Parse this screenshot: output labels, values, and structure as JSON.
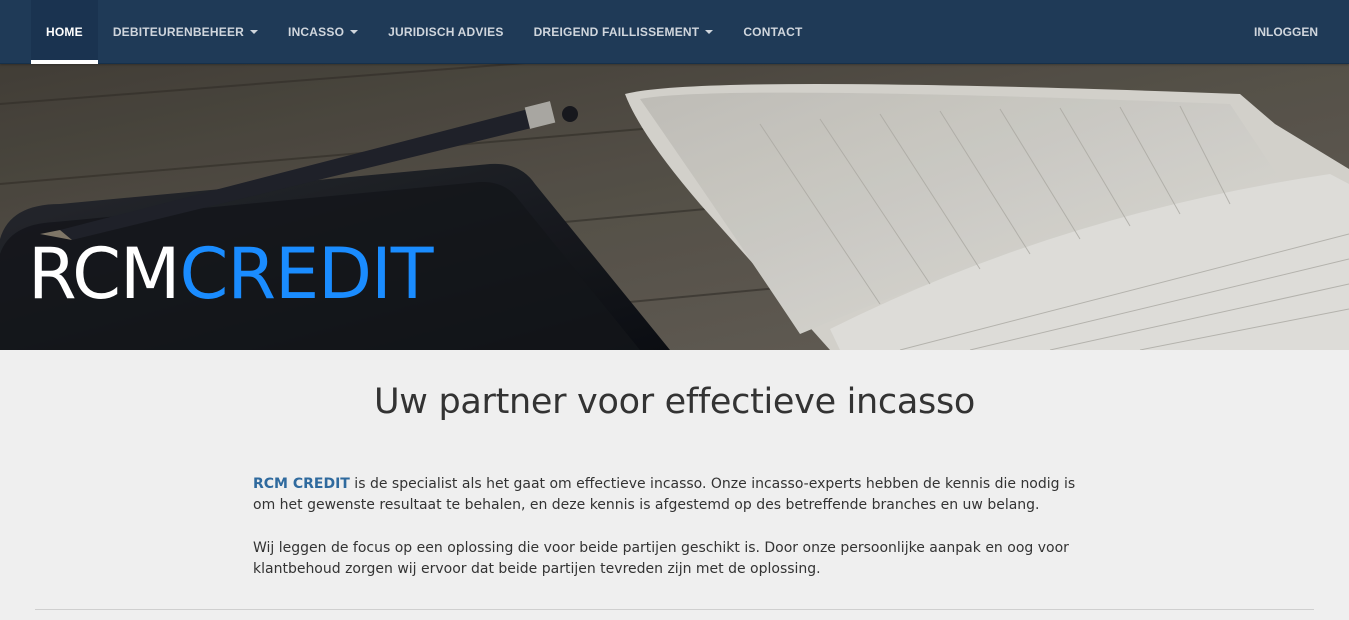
{
  "nav": {
    "items": [
      {
        "label": "HOME",
        "active": true,
        "dropdown": false
      },
      {
        "label": "DEBITEURENBEHEER",
        "active": false,
        "dropdown": true
      },
      {
        "label": "INCASSO",
        "active": false,
        "dropdown": true
      },
      {
        "label": "JURIDISCH ADVIES",
        "active": false,
        "dropdown": false
      },
      {
        "label": "DREIGEND FAILLISSEMENT",
        "active": false,
        "dropdown": true
      },
      {
        "label": "CONTACT",
        "active": false,
        "dropdown": false
      }
    ],
    "login_label": "INLOGGEN"
  },
  "hero": {
    "logo_part1": "RCM",
    "logo_part2": "CREDIT"
  },
  "main": {
    "heading": "Uw partner voor effectieve incasso",
    "para1_brand": "RCM CREDIT",
    "para1_text": " is de specialist als het gaat om effectieve incasso. Onze incasso-experts hebben de kennis die nodig is om het gewenste resultaat te behalen, en deze kennis is afgestemd op des betreffende branches en uw belang.",
    "para2_text": "Wij leggen de focus op een oplossing die voor beide partijen geschikt is. Door onze persoonlijke aanpak en oog voor klantbehoud zorgen wij ervoor dat beide partijen tevreden zijn met de oplossing."
  },
  "colors": {
    "navbar": "#1f3a57",
    "brand_blue": "#1a8cff",
    "brand_text": "#2f6a9e",
    "background": "#efefef"
  }
}
